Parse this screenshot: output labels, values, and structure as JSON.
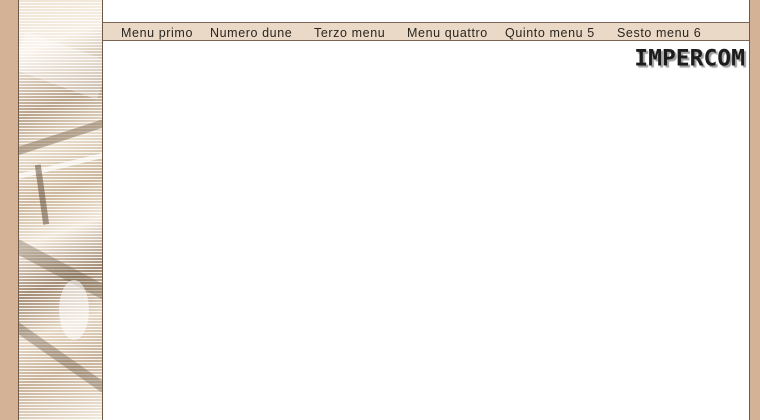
{
  "menu": {
    "items": [
      {
        "label": "Menu primo"
      },
      {
        "label": "Numero dune"
      },
      {
        "label": "Terzo menu"
      },
      {
        "label": "Menu quattro"
      },
      {
        "label": "Quinto menu 5"
      },
      {
        "label": "Sesto menu 6"
      }
    ]
  },
  "logo": {
    "text": "IMPERCOM"
  },
  "colors": {
    "page_background": "#d3b296",
    "menu_background": "#ead9c6",
    "content_background": "#ffffff"
  }
}
